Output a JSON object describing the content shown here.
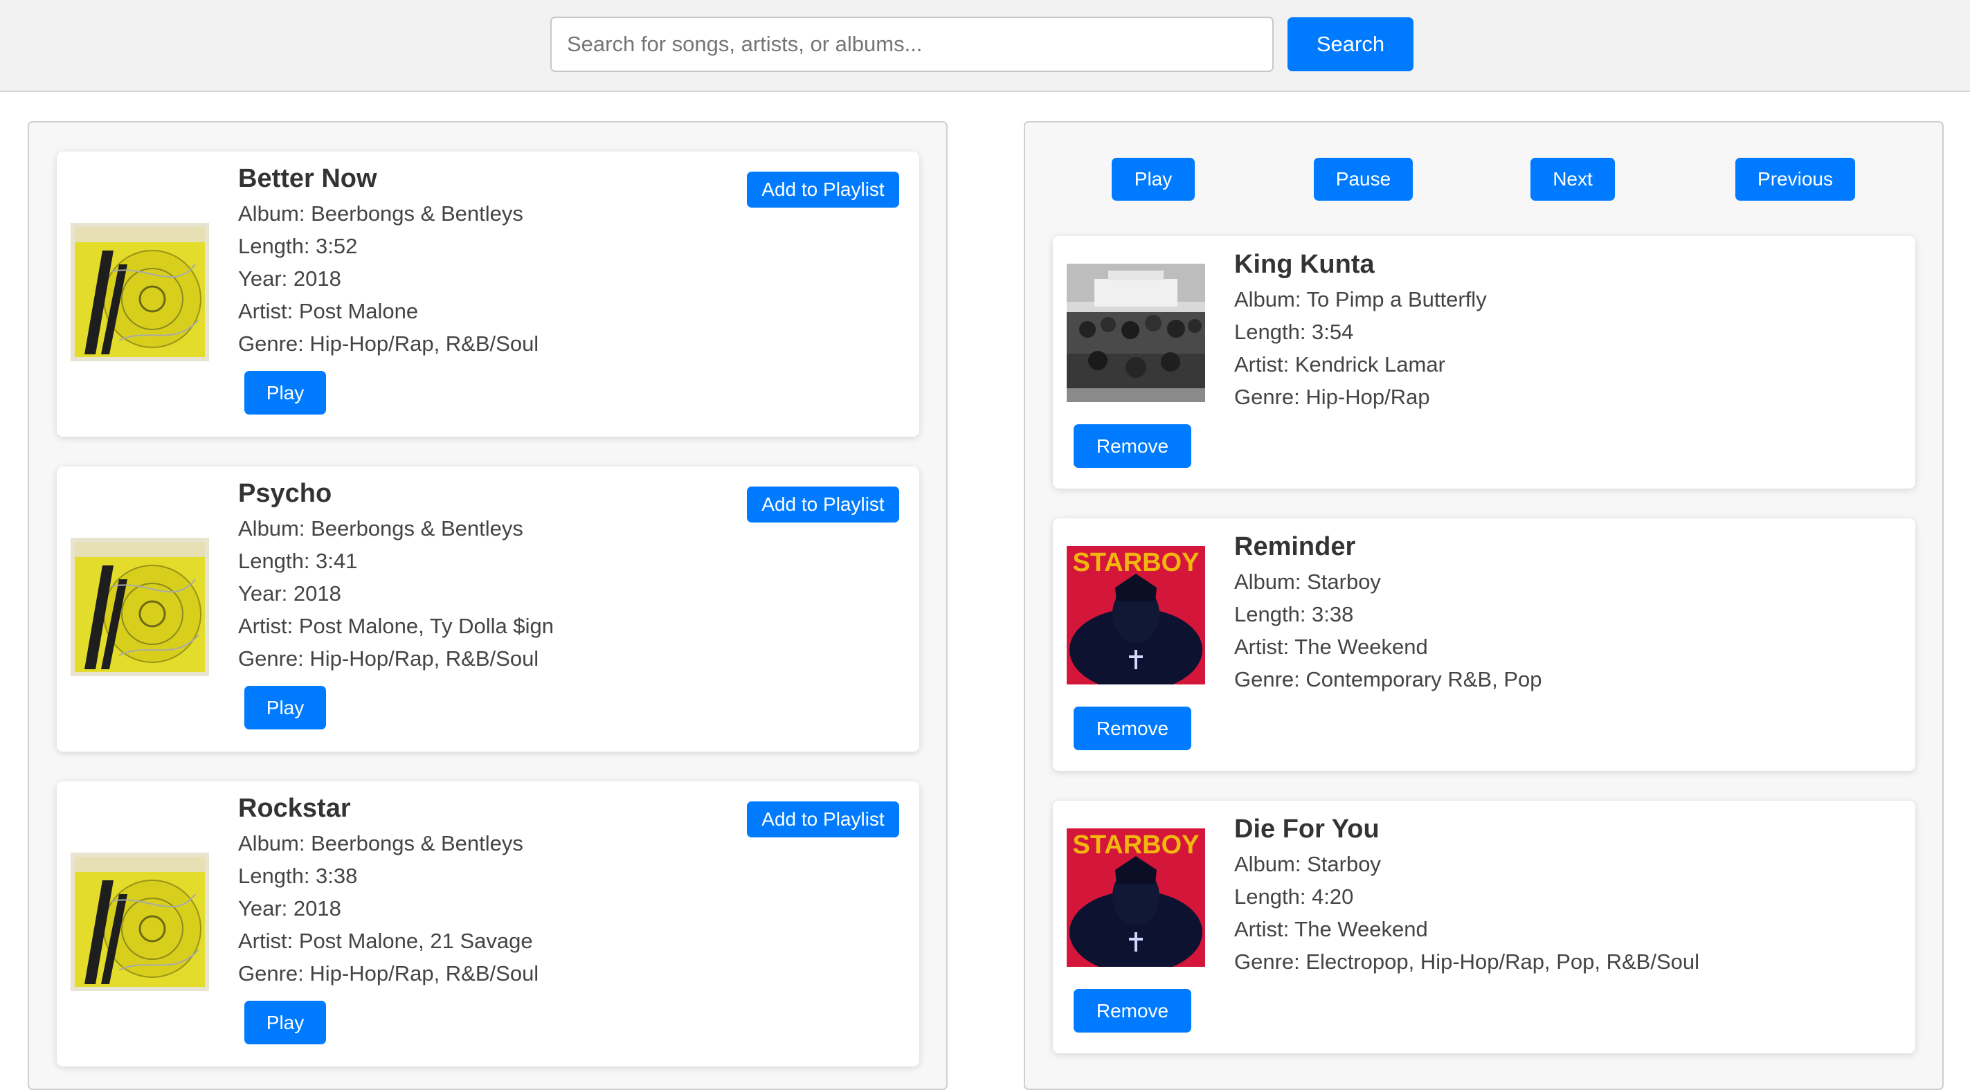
{
  "search": {
    "placeholder": "Search for songs, artists, or albums...",
    "button_label": "Search"
  },
  "results": [
    {
      "title": "Better Now",
      "album": "Album: Beerbongs & Bentleys",
      "length": "Length: 3:52",
      "year": "Year: 2018",
      "artist": "Artist: Post Malone",
      "genre": "Genre: Hip-Hop/Rap, R&B/Soul",
      "add_label": "Add to Playlist",
      "play_label": "Play",
      "art": "beerbongs-bentleys-cover"
    },
    {
      "title": "Psycho",
      "album": "Album: Beerbongs & Bentleys",
      "length": "Length: 3:41",
      "year": "Year: 2018",
      "artist": "Artist: Post Malone, Ty Dolla $ign",
      "genre": "Genre: Hip-Hop/Rap, R&B/Soul",
      "add_label": "Add to Playlist",
      "play_label": "Play",
      "art": "beerbongs-bentleys-cover"
    },
    {
      "title": "Rockstar",
      "album": "Album: Beerbongs & Bentleys",
      "length": "Length: 3:38",
      "year": "Year: 2018",
      "artist": "Artist: Post Malone, 21 Savage",
      "genre": "Genre: Hip-Hop/Rap, R&B/Soul",
      "add_label": "Add to Playlist",
      "play_label": "Play",
      "art": "beerbongs-bentleys-cover"
    }
  ],
  "player": {
    "play_label": "Play",
    "pause_label": "Pause",
    "next_label": "Next",
    "previous_label": "Previous"
  },
  "playlist": [
    {
      "title": "King Kunta",
      "album": "Album: To Pimp a Butterfly",
      "length": "Length: 3:54",
      "artist": "Artist: Kendrick Lamar",
      "genre": "Genre: Hip-Hop/Rap",
      "remove_label": "Remove",
      "art": "to-pimp-a-butterfly-cover"
    },
    {
      "title": "Reminder",
      "album": "Album: Starboy",
      "length": "Length: 3:38",
      "artist": "Artist: The Weekend",
      "genre": "Genre: Contemporary R&B, Pop",
      "remove_label": "Remove",
      "art": "starboy-cover"
    },
    {
      "title": "Die For You",
      "album": "Album: Starboy",
      "length": "Length: 4:20",
      "artist": "Artist: The Weekend",
      "genre": "Genre: Electropop, Hip-Hop/Rap, Pop, R&B/Soul",
      "remove_label": "Remove",
      "art": "starboy-cover"
    }
  ],
  "art_text": {
    "starboy": "STARBOY"
  },
  "colors": {
    "accent": "#007bff",
    "topbar": "#f2f2f2",
    "panel": "#f7f7f7"
  }
}
